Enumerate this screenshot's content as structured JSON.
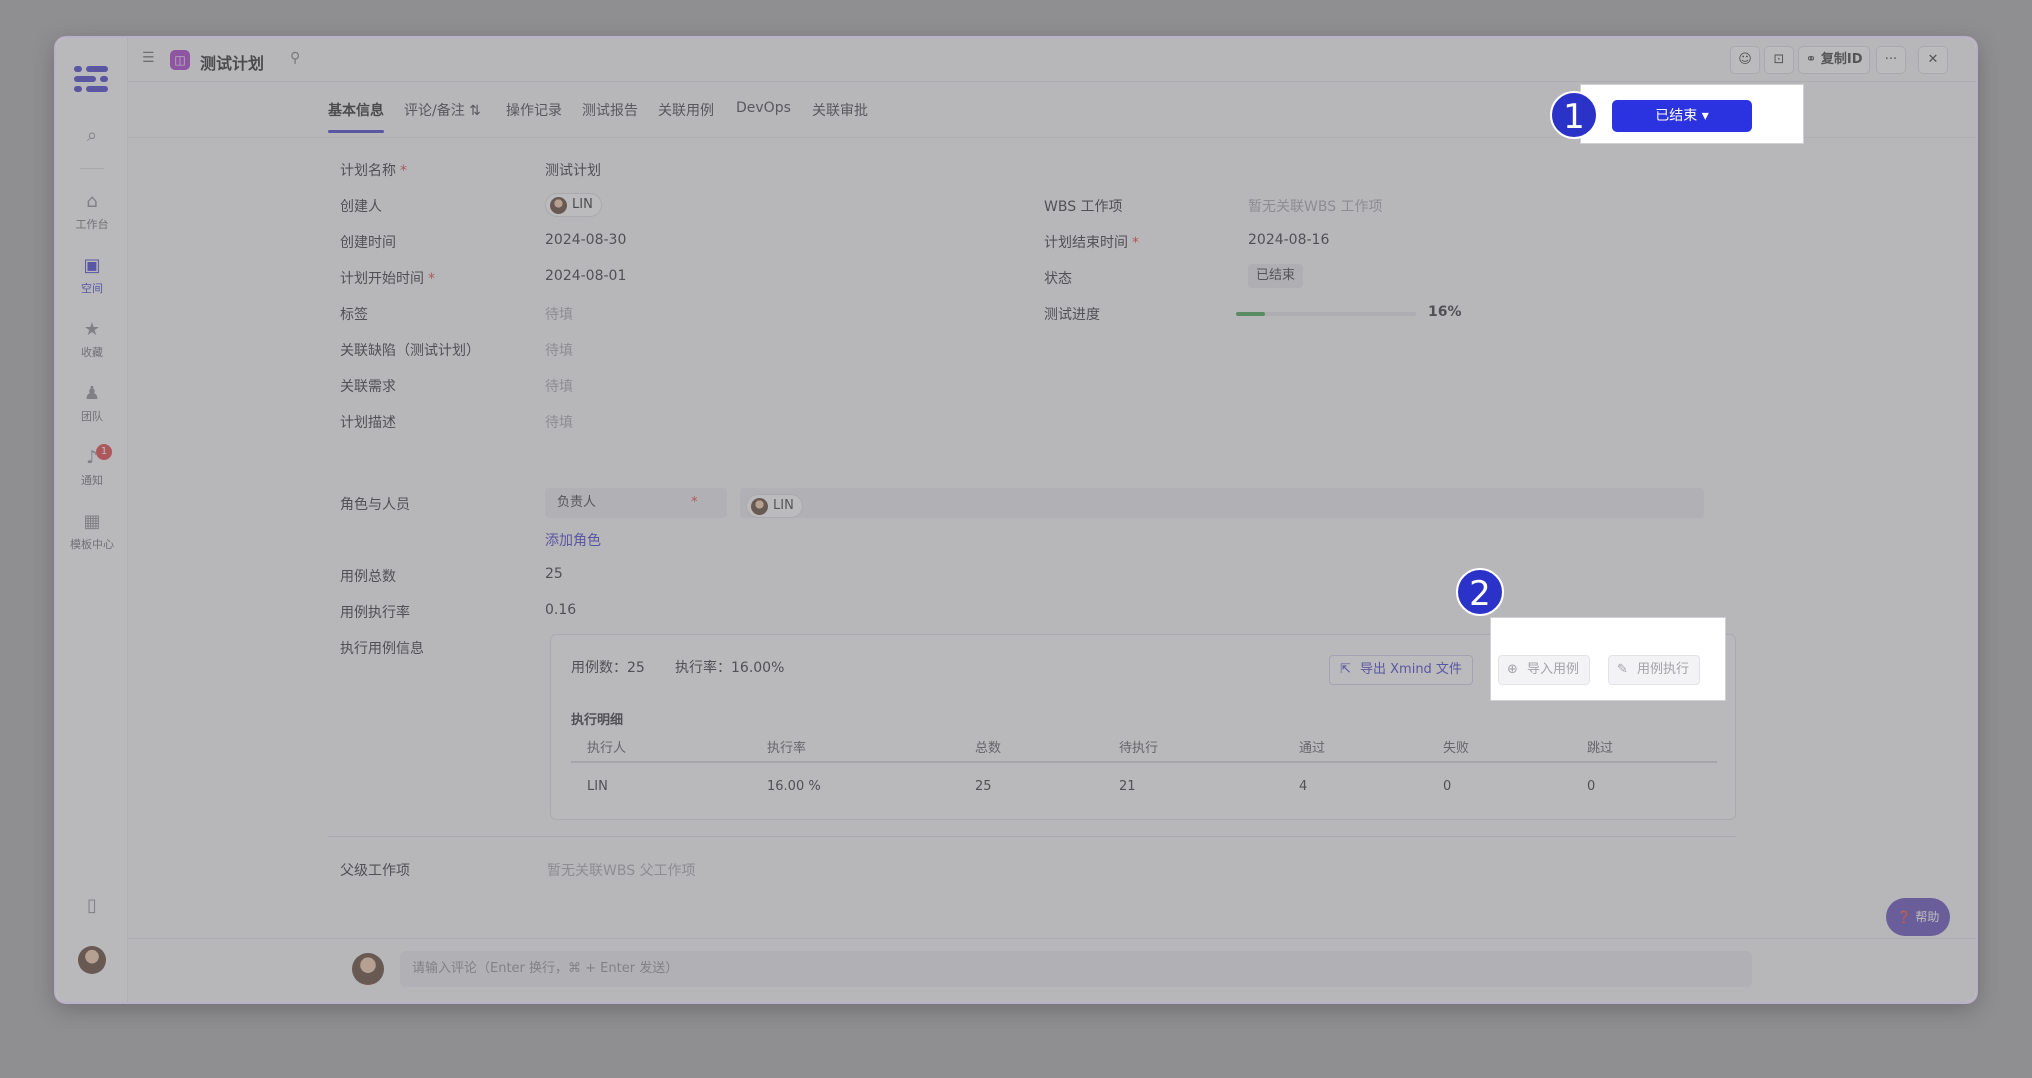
{
  "window": {
    "title": "测试计划"
  },
  "rail": {
    "items": [
      {
        "label": "工作台",
        "icon": "home-icon"
      },
      {
        "label": "空间",
        "icon": "space-icon"
      },
      {
        "label": "收藏",
        "icon": "star-icon"
      },
      {
        "label": "团队",
        "icon": "team-icon"
      },
      {
        "label": "通知",
        "icon": "bell-icon",
        "badge": "1"
      },
      {
        "label": "模板中心",
        "icon": "grid-icon"
      }
    ]
  },
  "header": {
    "copy_id": "复制ID"
  },
  "tabs": [
    {
      "label": "基本信息",
      "active": true
    },
    {
      "label": "评论/备注"
    },
    {
      "label": "操作记录"
    },
    {
      "label": "测试报告"
    },
    {
      "label": "关联用例"
    },
    {
      "label": "DevOps"
    },
    {
      "label": "关联审批"
    }
  ],
  "status_button": {
    "label": "已结束 ▾"
  },
  "markers": [
    "1",
    "2"
  ],
  "fields": {
    "plan_name": {
      "label": "计划名称",
      "value": "测试计划"
    },
    "creator": {
      "label": "创建人",
      "value": "LIN"
    },
    "created_at": {
      "label": "创建时间",
      "value": "2024-08-30"
    },
    "start_date": {
      "label": "计划开始时间",
      "value": "2024-08-01"
    },
    "tags": {
      "label": "标签",
      "value": "待填"
    },
    "defects": {
      "label": "关联缺陷（测试计划）",
      "value": "待填"
    },
    "requirements": {
      "label": "关联需求",
      "value": "待填"
    },
    "description": {
      "label": "计划描述",
      "value": "待填"
    },
    "wbs": {
      "label": "WBS 工作项",
      "value": "暂无关联WBS 工作项"
    },
    "end_date": {
      "label": "计划结束时间",
      "value": "2024-08-16"
    },
    "status": {
      "label": "状态",
      "value": "已结束"
    },
    "progress": {
      "label": "测试进度",
      "value": "16%",
      "fraction": 0.16
    }
  },
  "roles": {
    "label": "角色与人员",
    "role_name": "负责人",
    "member": "LIN",
    "add_role": "添加角色"
  },
  "case_total": {
    "label": "用例总数",
    "value": "25"
  },
  "case_rate": {
    "label": "用例执行率",
    "value": "0.16"
  },
  "exec_info": {
    "label": "执行用例信息",
    "summary_count": "用例数：25",
    "summary_rate": "执行率：16.00%",
    "btn_export": "导出 Xmind 文件",
    "btn_import": "导入用例",
    "btn_execute": "用例执行",
    "detail_title": "执行明细",
    "columns": [
      "执行人",
      "执行率",
      "总数",
      "待执行",
      "通过",
      "失败",
      "跳过"
    ],
    "rows": [
      [
        "LIN",
        "16.00 %",
        "25",
        "21",
        "4",
        "0",
        "0"
      ]
    ]
  },
  "parent": {
    "label": "父级工作项",
    "value": "暂无关联WBS 父工作项"
  },
  "comment": {
    "placeholder": "请输入评论（Enter 换行，⌘ + Enter 发送）"
  },
  "help": {
    "label": "帮助"
  }
}
